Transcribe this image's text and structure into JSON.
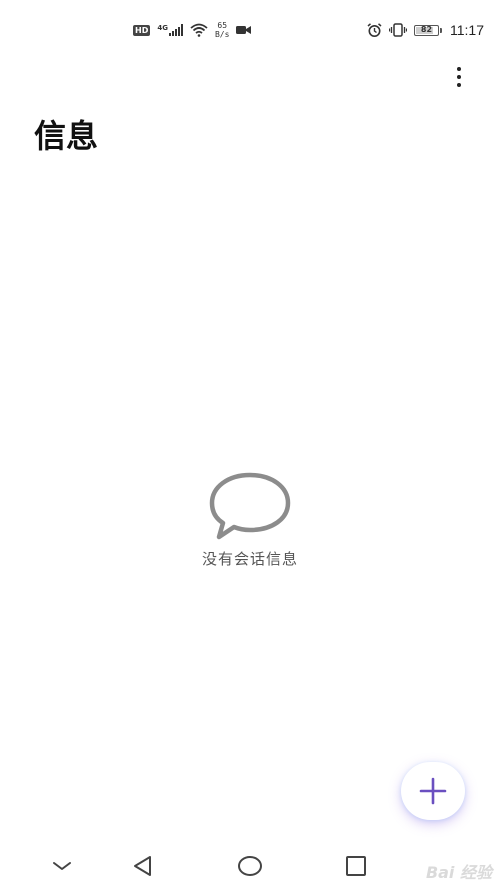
{
  "status_bar": {
    "hd_label": "HD",
    "network_type": "4G",
    "speed_value": "65",
    "speed_unit": "B/s",
    "battery_level": "82",
    "time": "11:17",
    "icons": [
      "hd-icon",
      "signal-icon",
      "wifi-icon",
      "video-camera-icon",
      "alarm-icon",
      "vibrate-icon",
      "battery-icon"
    ]
  },
  "header": {
    "title": "信息",
    "more_icon": "more-vertical-icon"
  },
  "empty_state": {
    "icon": "chat-bubble-icon",
    "text": "没有会话信息"
  },
  "fab": {
    "icon": "plus-icon",
    "accent_color": "#6a4fc0"
  },
  "nav_bar": {
    "icons": [
      "chevron-down-icon",
      "back-icon",
      "home-icon",
      "recents-icon"
    ]
  },
  "watermark": {
    "text": "Bai 经验"
  }
}
